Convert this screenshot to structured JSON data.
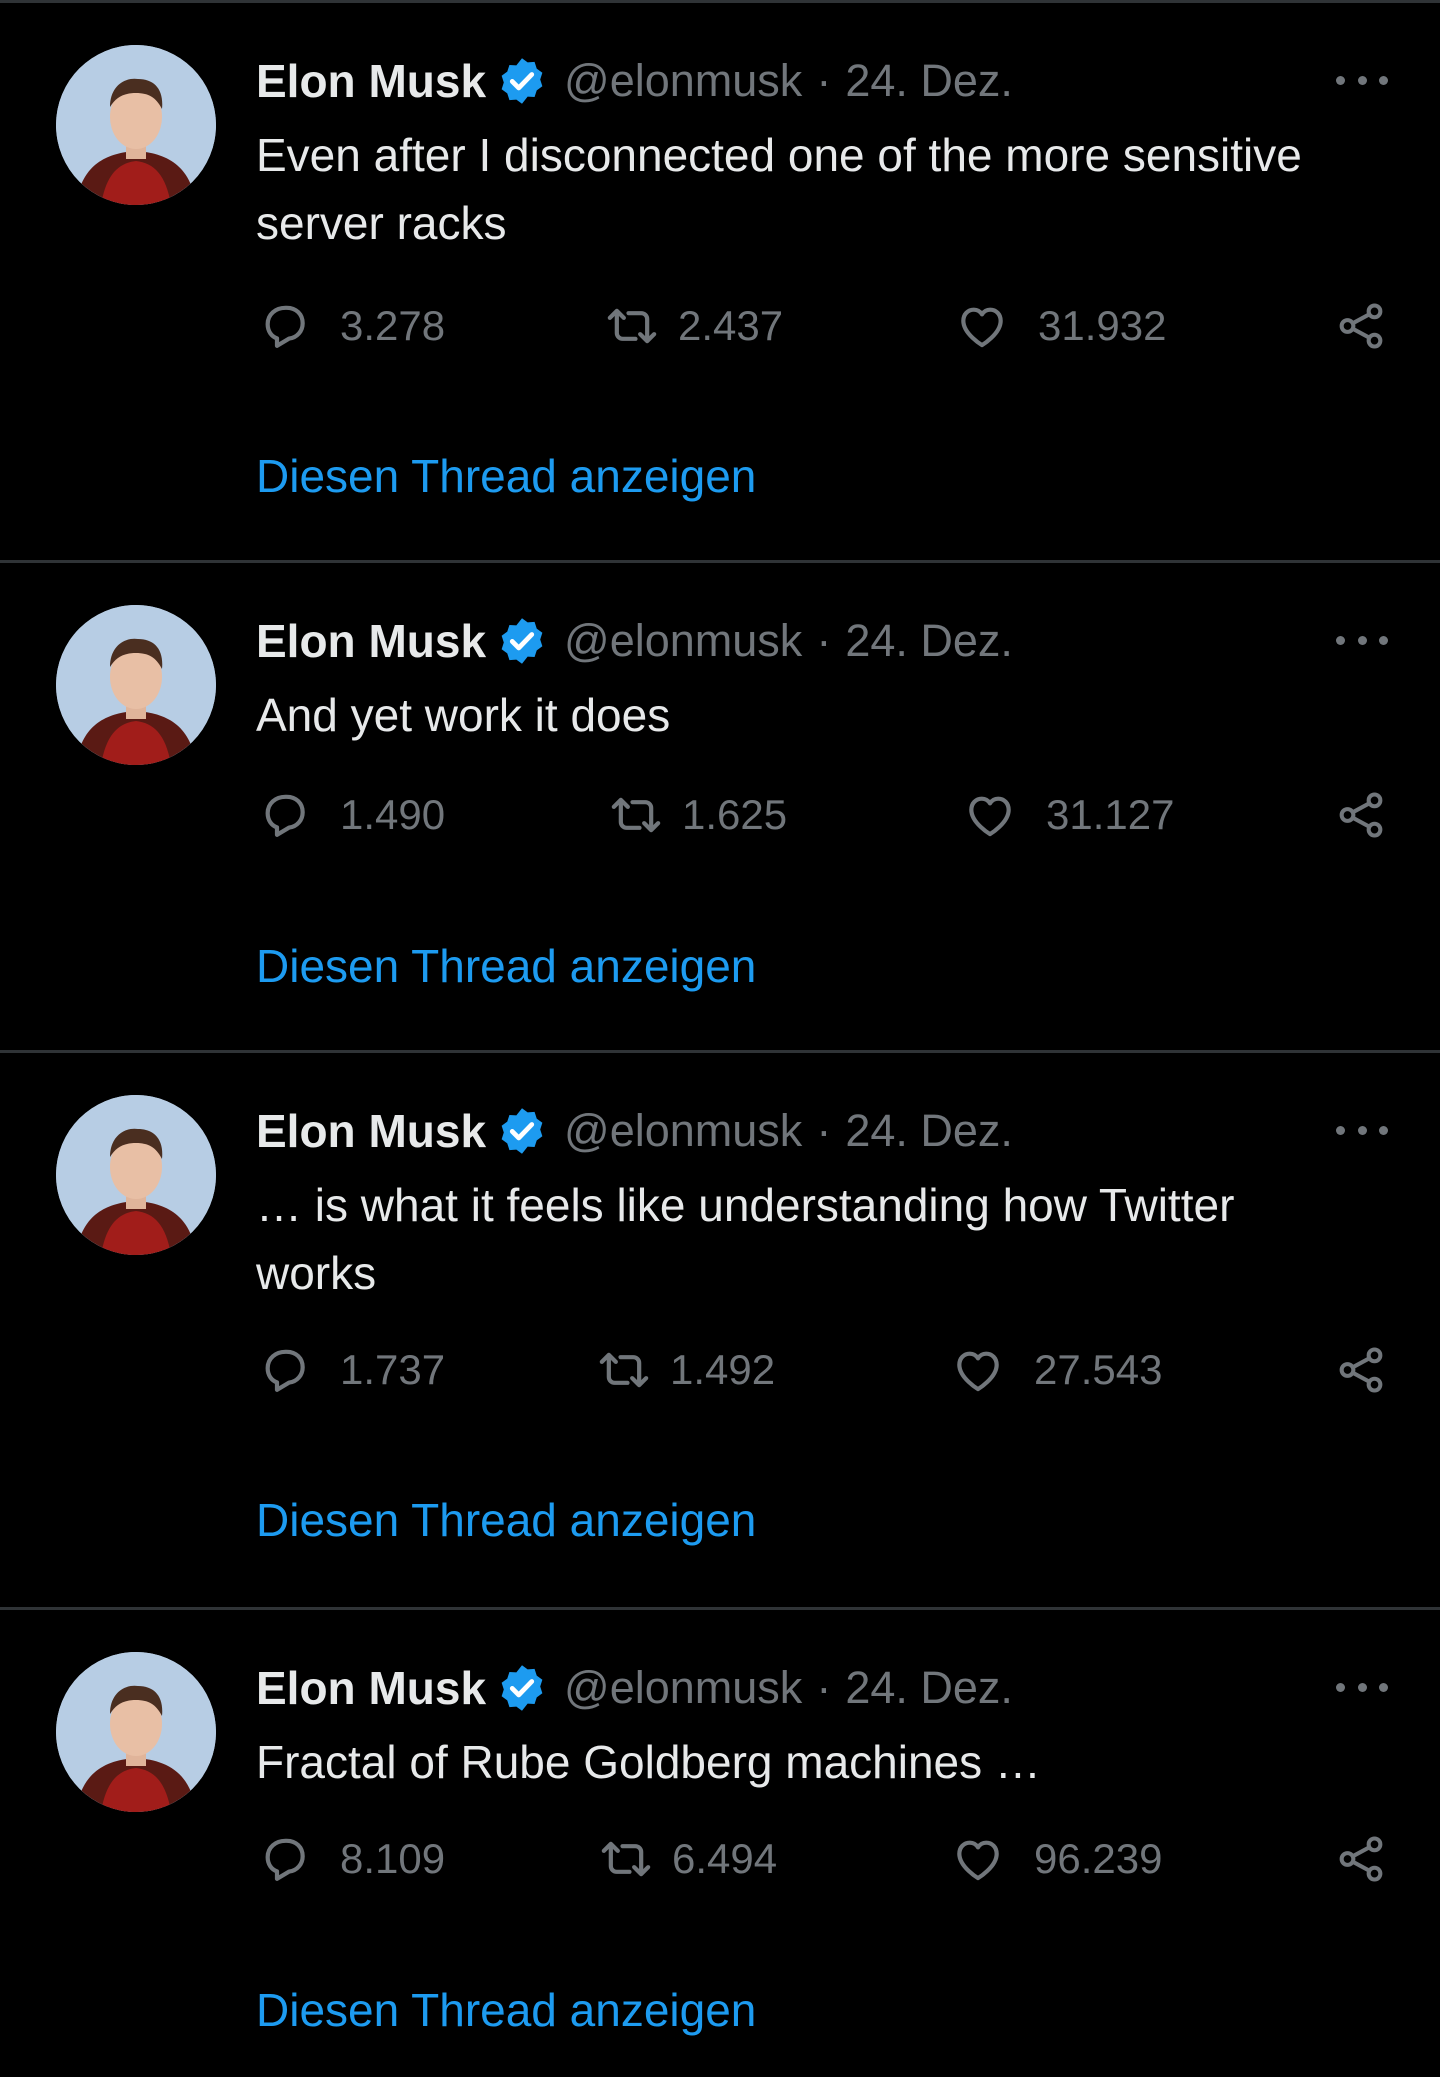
{
  "theme": {
    "background": "#000000",
    "text": "#e7e9ea",
    "secondary": "#71767b",
    "accent": "#1d9bf0",
    "divider": "#2f3336"
  },
  "tweets": [
    {
      "name": "Elon Musk",
      "handle": "@elonmusk",
      "separator": "·",
      "date": "24. Dez.",
      "text": "Even after I disconnected one of the more sensitive server racks",
      "replies": "3.278",
      "retweets": "2.437",
      "likes": "31.932",
      "thread_link": "Diesen Thread anzeigen"
    },
    {
      "name": "Elon Musk",
      "handle": "@elonmusk",
      "separator": "·",
      "date": "24. Dez.",
      "text": "And yet work it does",
      "replies": "1.490",
      "retweets": "1.625",
      "likes": "31.127",
      "thread_link": "Diesen Thread anzeigen"
    },
    {
      "name": "Elon Musk",
      "handle": "@elonmusk",
      "separator": "·",
      "date": "24. Dez.",
      "text": "… is what it feels like understanding how Twitter works",
      "replies": "1.737",
      "retweets": "1.492",
      "likes": "27.543",
      "thread_link": "Diesen Thread anzeigen"
    },
    {
      "name": "Elon Musk",
      "handle": "@elonmusk",
      "separator": "·",
      "date": "24. Dez.",
      "text": "Fractal of Rube Goldberg machines …",
      "replies": "8.109",
      "retweets": "6.494",
      "likes": "96.239",
      "thread_link": "Diesen Thread anzeigen"
    }
  ]
}
